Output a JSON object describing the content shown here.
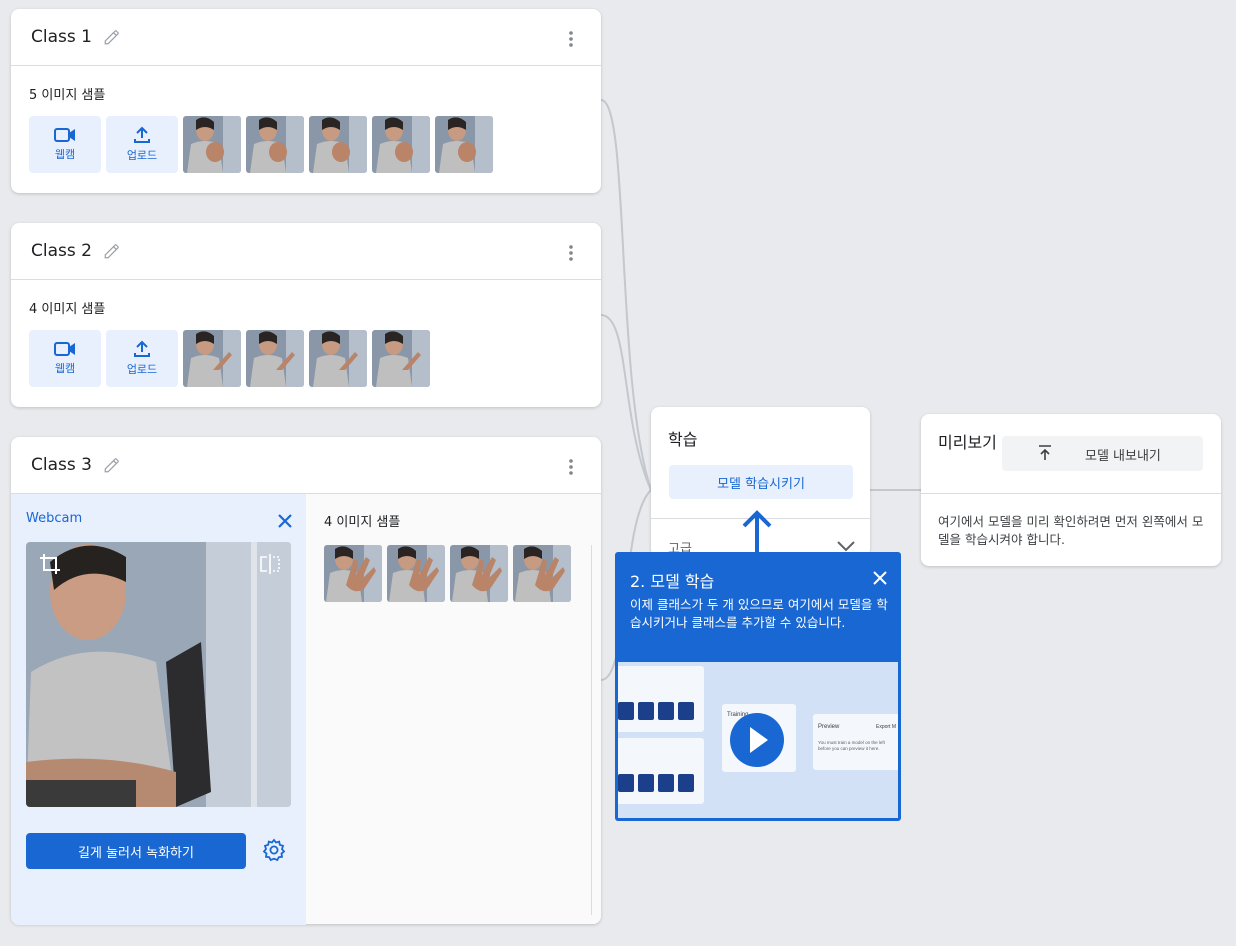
{
  "classes": [
    {
      "title": "Class 1",
      "samples_label": "5 이미지 샘플",
      "webcam_label": "웹캠",
      "upload_label": "업로드",
      "thumbnail_count": 5
    },
    {
      "title": "Class 2",
      "samples_label": "4 이미지 샘플",
      "webcam_label": "웹캠",
      "upload_label": "업로드",
      "thumbnail_count": 4
    },
    {
      "title": "Class 3",
      "samples_label": "4 이미지 샘플",
      "thumbnail_count": 4,
      "webcam_panel": {
        "title": "Webcam",
        "record_label": "길게 눌러서 녹화하기"
      }
    }
  ],
  "training": {
    "title": "학습",
    "train_button": "모델 학습시키기",
    "advanced_label": "고급"
  },
  "preview": {
    "title": "미리보기",
    "export_button": "모델 내보내기",
    "message": "여기에서 모델을 미리 확인하려면 먼저 왼쪽에서 모델을 학습시켜야 합니다."
  },
  "tooltip": {
    "title": "2. 모델 학습",
    "body": "이제 클래스가 두 개 있으므로 여기에서 모델을 학습시키거나 클래스를 추가할 수 있습니다.",
    "video_labels": {
      "training": "Training",
      "preview": "Preview",
      "export": "Export M",
      "note": "You must train a model on the left before you can preview it here."
    }
  },
  "icons": {
    "edit": "pencil-icon",
    "more": "more-vert-icon",
    "webcam": "videocam-icon",
    "upload": "upload-icon",
    "close": "close-icon",
    "crop": "crop-icon",
    "flip": "flip-icon",
    "settings": "gear-icon",
    "export": "export-icon",
    "chevron": "chevron-down-icon",
    "play": "play-icon"
  },
  "colors": {
    "accent": "#1967d2",
    "tile_bg": "#e8f0fe",
    "canvas_bg": "#e8eaed"
  }
}
